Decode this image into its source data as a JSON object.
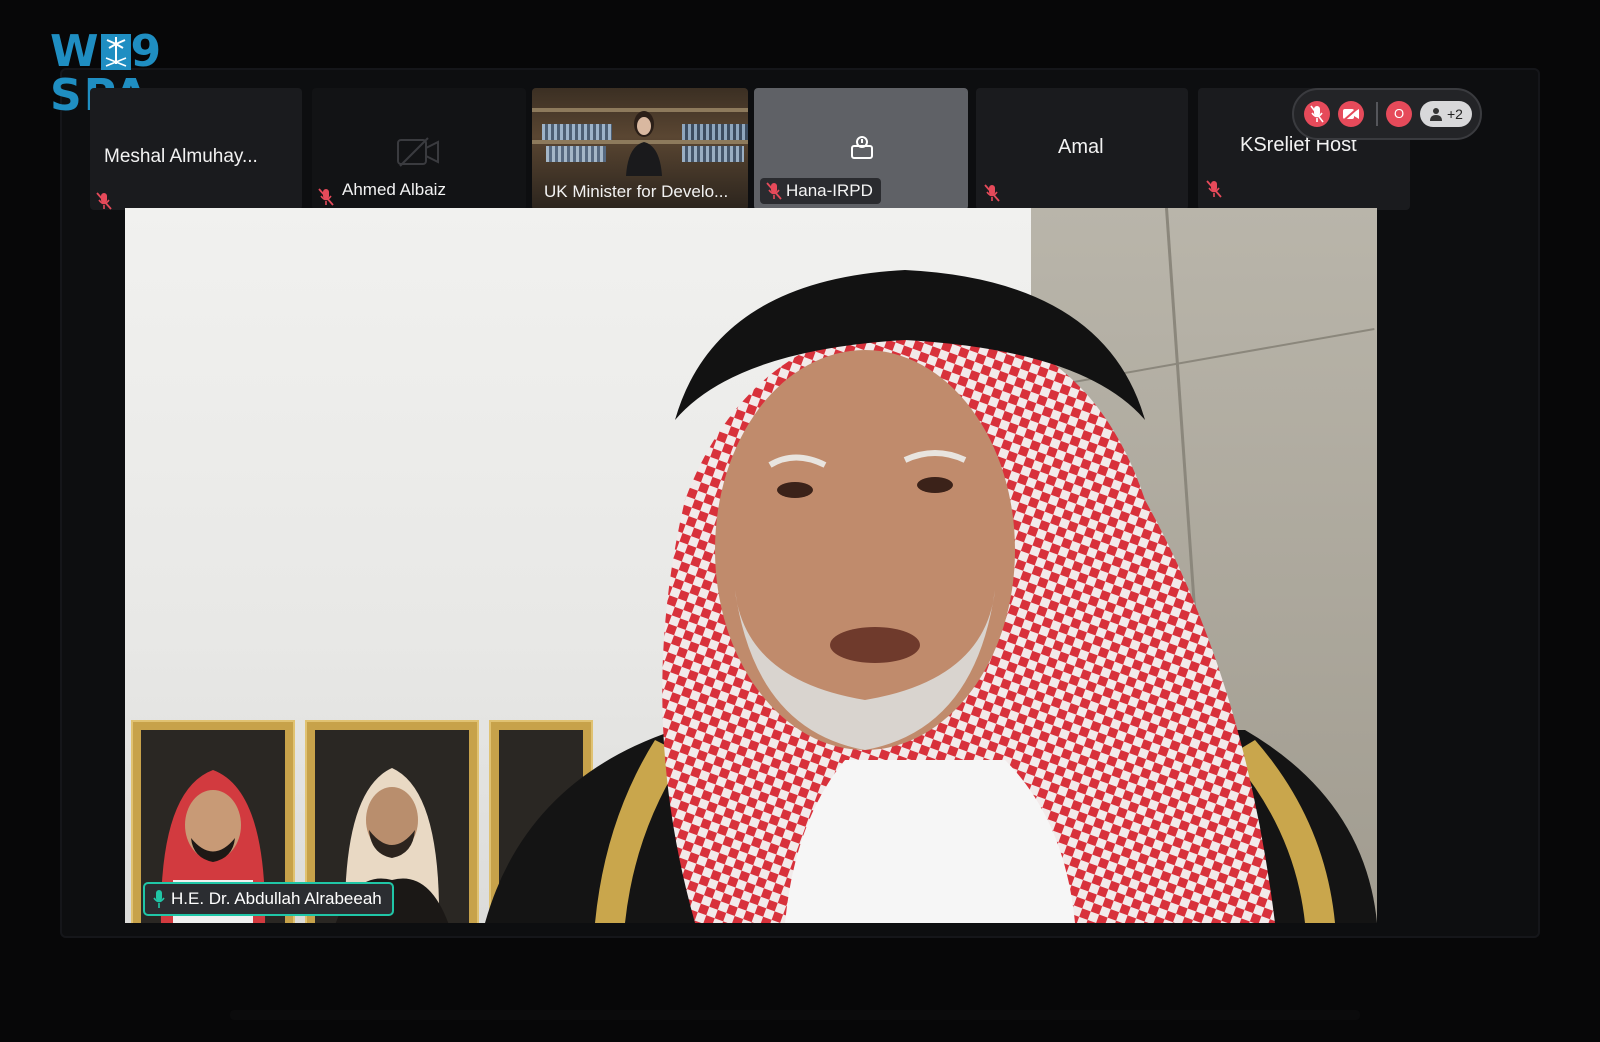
{
  "logo": {
    "line1_left": "W",
    "line1_right": "9",
    "line2": "SPA",
    "color": "#1f8ec2"
  },
  "participants": [
    {
      "name": "Meshal Almuhay...",
      "muted": true
    },
    {
      "name": "Ahmed Albaiz",
      "muted": true,
      "camera_off": true
    },
    {
      "name": "UK Minister for Develo...",
      "muted": false,
      "video": true
    },
    {
      "name": "Hana-IRPD",
      "muted": true,
      "active": true
    },
    {
      "name": "Amal",
      "muted": true
    },
    {
      "name": "KSrelief Host",
      "muted": true
    }
  ],
  "controls": {
    "more_participants": "+2",
    "record_label": "O"
  },
  "speaker": {
    "name": "H.E. Dr. Abdullah Alrabeeah",
    "mic_active": true
  },
  "colors": {
    "accent": "#20c6a7",
    "danger": "#e64a5a",
    "tile_bg": "#1a1b1e"
  }
}
